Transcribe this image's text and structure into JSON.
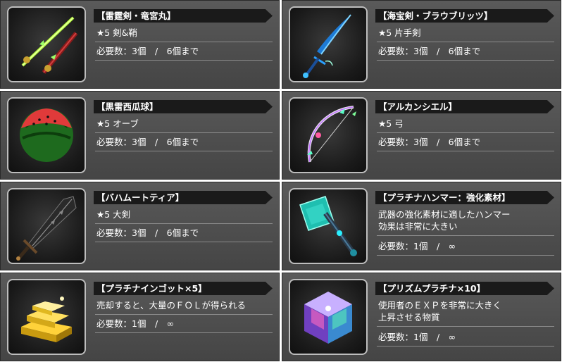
{
  "items": [
    {
      "title": "【雷霆剣・竜宮丸】",
      "line1": "★5 剣&鞘",
      "line2": "",
      "req": "必要数：3個　/　6個まで",
      "icon": "katana-sheath-icon"
    },
    {
      "title": "【海宝剣・ブラウブリッツ】",
      "line1": "★5 片手剣",
      "line2": "",
      "req": "必要数：3個　/　6個まで",
      "icon": "blue-sword-icon"
    },
    {
      "title": "【黒雷西瓜球】",
      "line1": "★5 オーブ",
      "line2": "",
      "req": "必要数：3個　/　6個まで",
      "icon": "watermelon-orb-icon"
    },
    {
      "title": "【アルカンシエル】",
      "line1": "★5 弓",
      "line2": "",
      "req": "必要数：3個　/　6個まで",
      "icon": "bow-icon"
    },
    {
      "title": "【バハムートティア】",
      "line1": "★5 大剣",
      "line2": "",
      "req": "必要数：3個　/　6個まで",
      "icon": "greatsword-icon"
    },
    {
      "title": "【プラチナハンマー：強化素材】",
      "line1": "武器の強化素材に適したハンマー",
      "line2": "効果は非常に大きい",
      "req": "必要数：1個　/　∞",
      "icon": "platinum-hammer-icon"
    },
    {
      "title": "【プラチナインゴット×5】",
      "line1": "売却すると、大量のＦＯＬが得られる",
      "line2": "",
      "req": "必要数：1個　/　∞",
      "icon": "gold-ingot-icon"
    },
    {
      "title": "【プリズムプラチナ×10】",
      "line1": "使用者のＥＸＰを非常に大きく",
      "line2": "上昇させる物質",
      "req": "必要数：1個　/　∞",
      "icon": "prism-cube-icon"
    }
  ]
}
